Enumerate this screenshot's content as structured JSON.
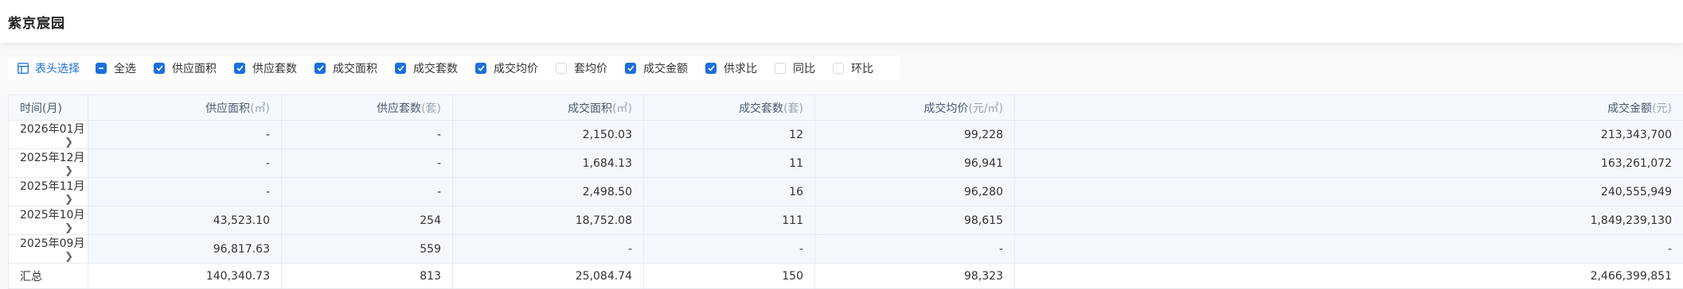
{
  "page": {
    "title": "紫京宸园"
  },
  "toolbar": {
    "header_select_label": "表头选择",
    "select_all": {
      "label": "全选",
      "state": "indeterminate"
    },
    "options": [
      {
        "label": "供应面积",
        "checked": true
      },
      {
        "label": "供应套数",
        "checked": true
      },
      {
        "label": "成交面积",
        "checked": true
      },
      {
        "label": "成交套数",
        "checked": true
      },
      {
        "label": "成交均价",
        "checked": true
      },
      {
        "label": "套均价",
        "checked": false
      },
      {
        "label": "成交金额",
        "checked": true
      },
      {
        "label": "供求比",
        "checked": true
      },
      {
        "label": "同比",
        "checked": false
      },
      {
        "label": "环比",
        "checked": false
      }
    ]
  },
  "table": {
    "columns": [
      {
        "label": "时间(月)",
        "unit": ""
      },
      {
        "label": "供应面积",
        "unit": "(㎡)"
      },
      {
        "label": "供应套数",
        "unit": "(套)"
      },
      {
        "label": "成交面积",
        "unit": "(㎡)"
      },
      {
        "label": "成交套数",
        "unit": "(套)"
      },
      {
        "label": "成交均价",
        "unit": "(元/㎡)"
      },
      {
        "label": "成交金额",
        "unit": "(元)"
      }
    ],
    "rows": [
      {
        "month": "2026年01月",
        "supply_area": "-",
        "supply_units": "-",
        "deal_area": "2,150.03",
        "deal_units": "12",
        "avg_price": "99,228",
        "amount": "213,343,700"
      },
      {
        "month": "2025年12月",
        "supply_area": "-",
        "supply_units": "-",
        "deal_area": "1,684.13",
        "deal_units": "11",
        "avg_price": "96,941",
        "amount": "163,261,072"
      },
      {
        "month": "2025年11月",
        "supply_area": "-",
        "supply_units": "-",
        "deal_area": "2,498.50",
        "deal_units": "16",
        "avg_price": "96,280",
        "amount": "240,555,949"
      },
      {
        "month": "2025年10月",
        "supply_area": "43,523.10",
        "supply_units": "254",
        "deal_area": "18,752.08",
        "deal_units": "111",
        "avg_price": "98,615",
        "amount": "1,849,239,130"
      },
      {
        "month": "2025年09月",
        "supply_area": "96,817.63",
        "supply_units": "559",
        "deal_area": "-",
        "deal_units": "-",
        "avg_price": "-",
        "amount": "-"
      }
    ],
    "summary": {
      "month": "汇总",
      "supply_area": "140,340.73",
      "supply_units": "813",
      "deal_area": "25,084.74",
      "deal_units": "150",
      "avg_price": "98,323",
      "amount": "2,466,399,851"
    }
  },
  "icons": {
    "table_icon": "table-columns-icon",
    "row_expand": "chevron-right-icon",
    "check": "check-icon"
  },
  "colors": {
    "accent": "#1b6fdc",
    "header_bg": "#f5f8fc",
    "row_bg": "#f4f8fd",
    "page_bg": "#f7f9fb"
  }
}
